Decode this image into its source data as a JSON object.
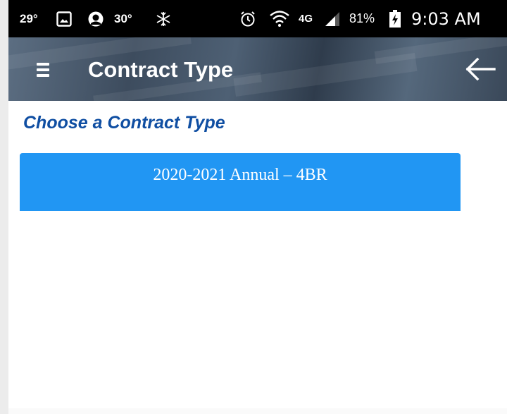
{
  "status_bar": {
    "temp_left": "29°",
    "temp_right": "30°",
    "network": "4G",
    "battery": "81%",
    "time": "9:03 AM"
  },
  "app_bar": {
    "title": "Contract Type"
  },
  "main": {
    "heading": "Choose a Contract Type",
    "contracts": [
      {
        "label": "2020-2021 Annual – 4BR"
      }
    ]
  },
  "colors": {
    "status_bar_bg": "#000000",
    "heading": "#0f4ea2",
    "button_bg": "#2196f3",
    "button_text": "#ffffff"
  },
  "icons": [
    "image-icon",
    "weather-icon",
    "snowflake-icon",
    "alarm-icon",
    "wifi-icon",
    "signal-icon",
    "battery-charging-icon",
    "menu-icon",
    "back-arrow-icon"
  ]
}
